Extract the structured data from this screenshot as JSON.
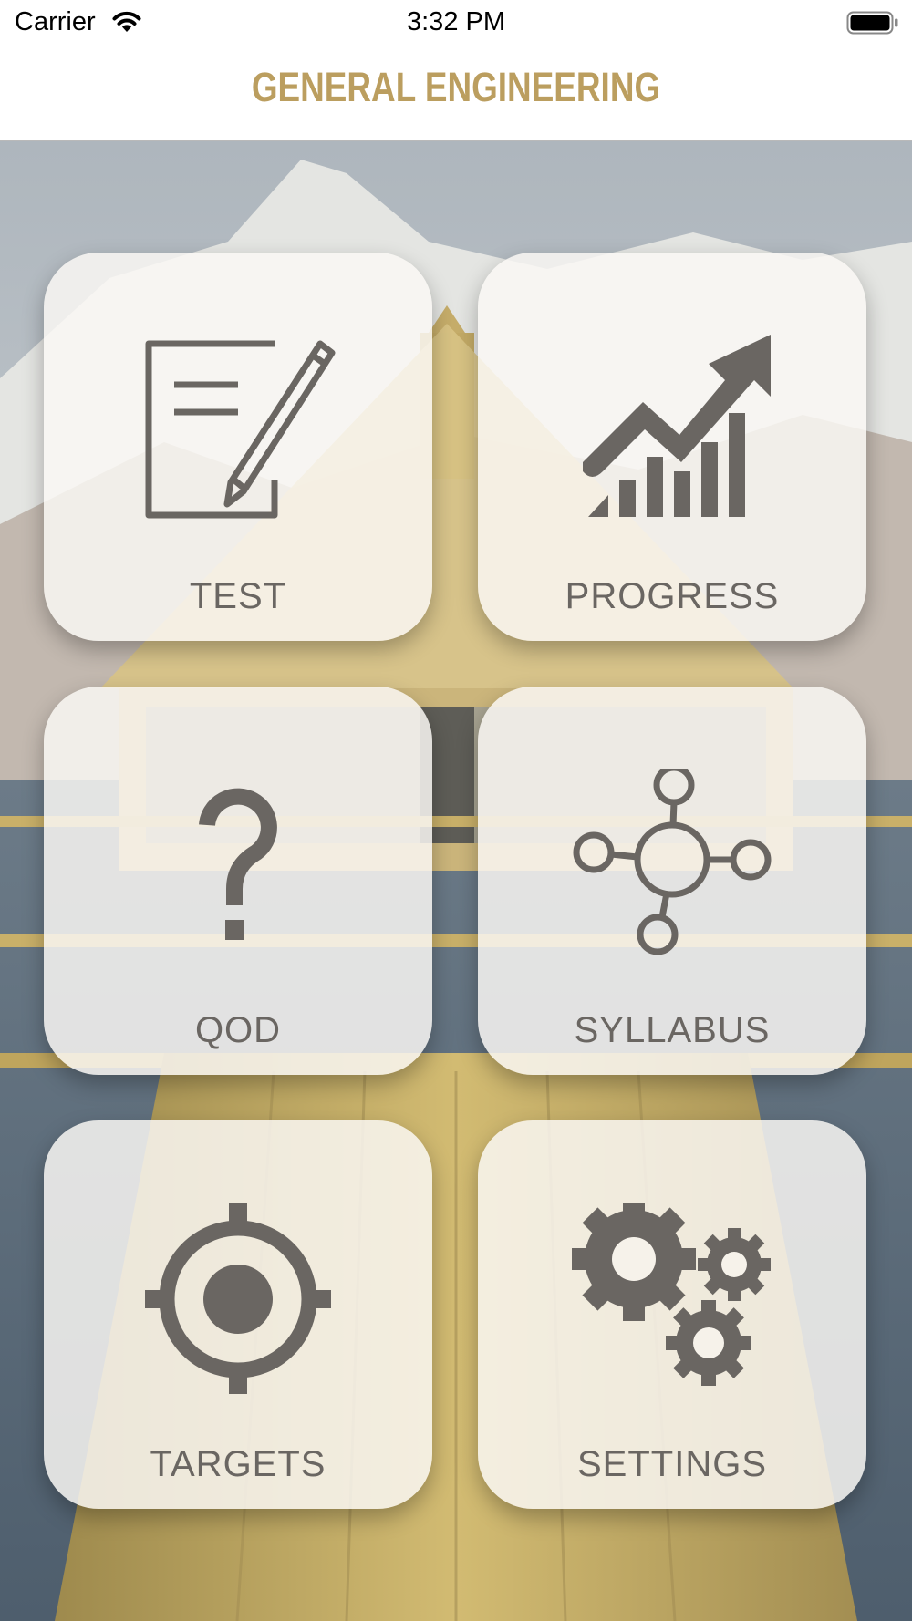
{
  "status_bar": {
    "carrier": "Carrier",
    "time": "3:32 PM"
  },
  "header": {
    "title": "GENERAL ENGINEERING"
  },
  "menu": {
    "items": [
      {
        "label": "TEST",
        "icon": "test-paper-pencil-icon"
      },
      {
        "label": "PROGRESS",
        "icon": "progress-chart-icon"
      },
      {
        "label": "QOD",
        "icon": "question-mark-icon"
      },
      {
        "label": "SYLLABUS",
        "icon": "syllabus-network-icon"
      },
      {
        "label": "TARGETS",
        "icon": "target-crosshair-icon"
      },
      {
        "label": "SETTINGS",
        "icon": "gears-icon"
      }
    ]
  },
  "colors": {
    "accent": "#bb9e5f",
    "icon": "#6a6662",
    "tile_bg": "#faf8f4"
  }
}
